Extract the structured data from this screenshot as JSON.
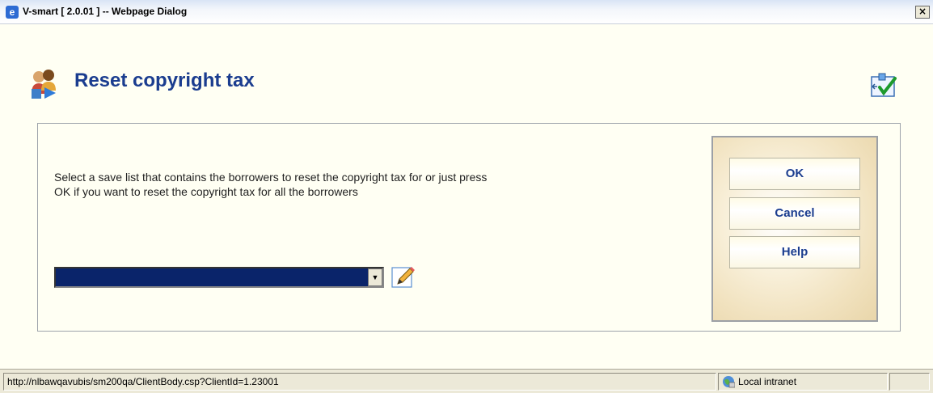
{
  "window": {
    "title": "V-smart [ 2.0.01 ] -- Webpage Dialog",
    "close_label": "×"
  },
  "page": {
    "title": "Reset copyright tax",
    "instructions_line1": "Select a save list that contains the borrowers to reset the copyright tax for or just press",
    "instructions_line2": "OK if you want to reset the copyright tax for all the borrowers"
  },
  "form": {
    "savelist_value": ""
  },
  "buttons": {
    "ok": "OK",
    "cancel": "Cancel",
    "help": "Help"
  },
  "statusbar": {
    "url": "http://nlbawqavubis/sm200qa/ClientBody.csp?ClientId=1.23001",
    "zone": "Local intranet"
  },
  "colors": {
    "title_blue": "#1b3d8f",
    "page_background": "#fffff3",
    "dropdown_selected": "#0a246a"
  }
}
